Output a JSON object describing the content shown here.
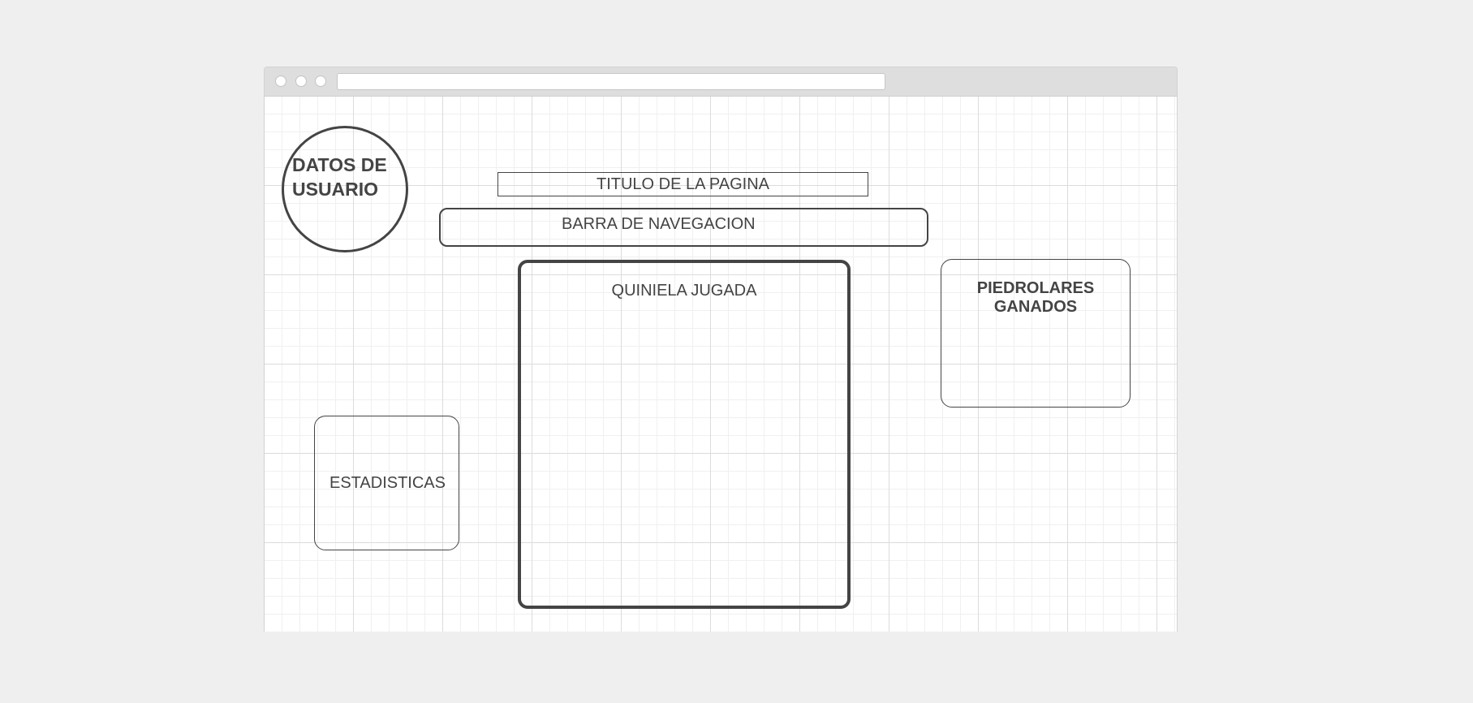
{
  "mockup": {
    "title_box": "TITULO DE LA PAGINA",
    "nav_box": "BARRA DE NAVEGACION",
    "user_data": "DATOS DE USUARIO",
    "quiniela": "QUINIELA JUGADA",
    "piedrolares": "PIEDROLARES GANADOS",
    "statistics": "ESTADISTICAS"
  },
  "colors": {
    "background": "#efefef",
    "chrome": "#dedede",
    "stroke": "#444444",
    "grid_major": "#dcdcdc",
    "grid_minor": "#f0f0f0"
  }
}
